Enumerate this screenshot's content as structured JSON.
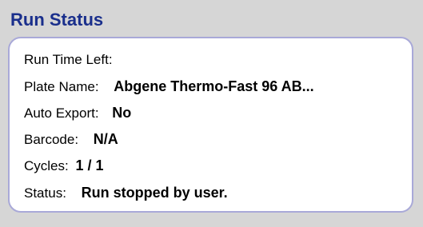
{
  "panel": {
    "title": "Run Status"
  },
  "fields": {
    "run_time_left_label": "Run Time Left:",
    "run_time_left_value": "",
    "plate_name_label": "Plate Name:",
    "plate_name_value": "Abgene Thermo-Fast 96 AB...",
    "auto_export_label": "Auto Export:",
    "auto_export_value": "No",
    "barcode_label": "Barcode:",
    "barcode_value": "N/A",
    "cycles_label": "Cycles:",
    "cycles_value": "1 / 1",
    "status_label": "Status:",
    "status_value": "Run stopped by user."
  },
  "colors": {
    "title": "#1a2f8c",
    "background": "#d6d6d6",
    "box_border": "#a9a9d8",
    "box_fill": "#ffffff"
  }
}
